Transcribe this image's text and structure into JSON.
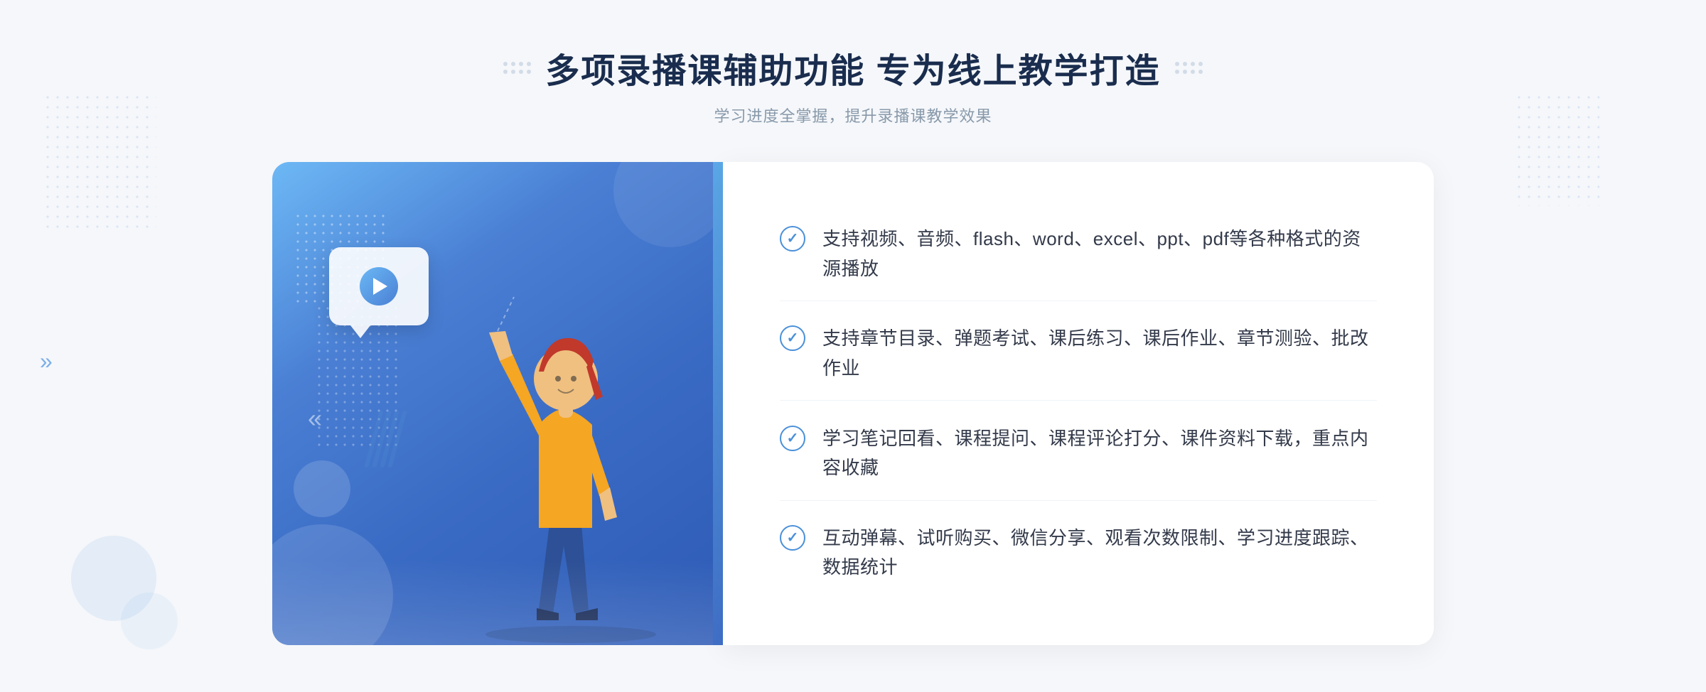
{
  "header": {
    "title": "多项录播课辅助功能 专为线上教学打造",
    "subtitle": "学习进度全掌握，提升录播课教学效果",
    "left_dots_label": "left-decoration-dots",
    "right_dots_label": "right-decoration-dots"
  },
  "features": [
    {
      "id": 1,
      "text": "支持视频、音频、flash、word、excel、ppt、pdf等各种格式的资源播放"
    },
    {
      "id": 2,
      "text": "支持章节目录、弹题考试、课后练习、课后作业、章节测验、批改作业"
    },
    {
      "id": 3,
      "text": "学习笔记回看、课程提问、课程评论打分、课件资料下载，重点内容收藏"
    },
    {
      "id": 4,
      "text": "互动弹幕、试听购买、微信分享、观看次数限制、学习进度跟踪、数据统计"
    }
  ],
  "chevron_symbol": "»",
  "play_label": "play-video",
  "check_symbol": "✓",
  "illustration_alt": "online teaching illustration"
}
